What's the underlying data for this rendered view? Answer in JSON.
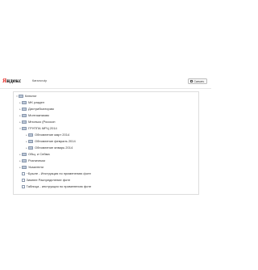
{
  "header": {
    "logo_first": "Я",
    "logo_rest": "ндекс",
    "doc_title": "Каталог.zip",
    "save_label": "Скачать"
  },
  "tree": {
    "root": "Каталог",
    "items": [
      {
        "label": "MK раздел",
        "type": "folder"
      },
      {
        "label": "Дистрибьюторам",
        "type": "folder"
      },
      {
        "label": "Монтажникам",
        "type": "folder"
      },
      {
        "label": "Мнолько (Росскон",
        "type": "folder"
      },
      {
        "label": "ГРУППА МРЦ 2014",
        "type": "folder"
      },
      {
        "label": "Обновление март 2014",
        "type": "folder"
      },
      {
        "label": "Обновление февраль 2014",
        "type": "folder"
      },
      {
        "label": "Обновление январь 2014",
        "type": "folder"
      },
      {
        "label": "Общ. и Сейма",
        "type": "folder"
      },
      {
        "label": "Розничным",
        "type": "folder"
      },
      {
        "label": "Указатели",
        "type": "folder"
      },
      {
        "label": "~Брыле - Инструкция по применению фоте",
        "type": "file"
      },
      {
        "label": "Зимнее Распределение фоте",
        "type": "file"
      },
      {
        "label": "Таблица - инструкция по применению фоте",
        "type": "file"
      }
    ]
  }
}
